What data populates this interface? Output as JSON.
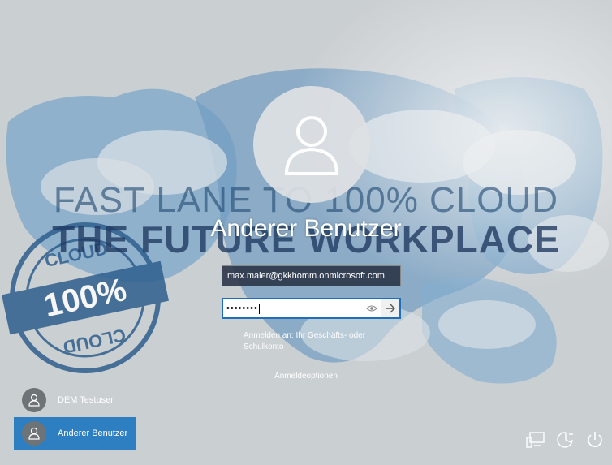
{
  "background": {
    "tagline_line1": "FAST LANE TO 100% CLOUD",
    "tagline_line2": "THE FUTURE WORKPLACE",
    "stamp_top": "CLOUD",
    "stamp_center": "100%",
    "stamp_bottom": "CLOUD"
  },
  "login": {
    "user_title": "Anderer Benutzer",
    "email_value": "max.maier@gkkhomm.onmicrosoft.com",
    "password_masked": "••••••••",
    "signin_hint": "Anmelden an: Ihr Geschäfts- oder Schulkonto",
    "signin_options": "Anmeldeoptionen"
  },
  "users": [
    {
      "label": "DEM Testuser",
      "selected": false
    },
    {
      "label": "Anderer Benutzer",
      "selected": true
    }
  ],
  "system_icons": [
    "network-icon",
    "ease-of-access-icon",
    "power-icon"
  ],
  "colors": {
    "accent": "#2d7fc1",
    "password_border": "#1e6fb8",
    "email_bg": "#283246"
  }
}
